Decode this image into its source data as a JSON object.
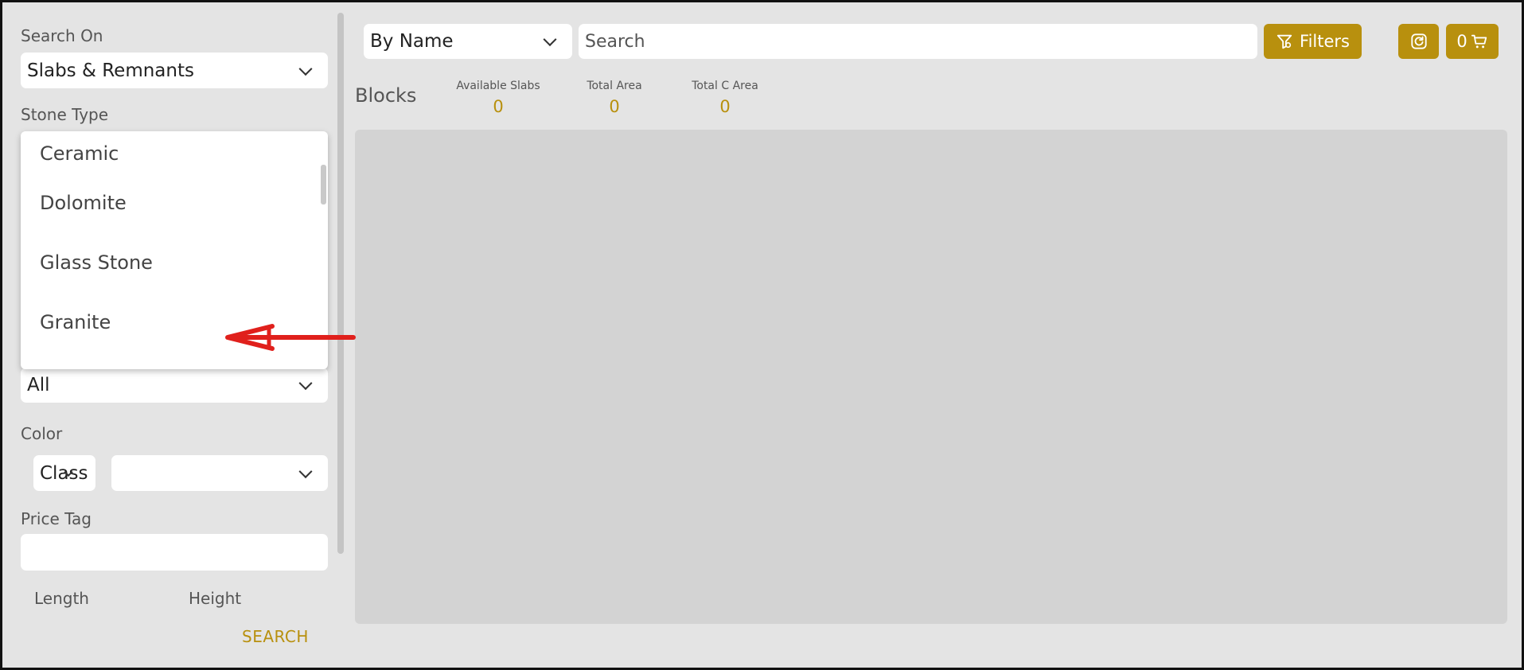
{
  "sidebar": {
    "search_on": {
      "label": "Search On",
      "value": "Slabs & Remnants"
    },
    "stone_type": {
      "label": "Stone Type",
      "options": [
        "Ceramic",
        "Dolomite",
        "Glass Stone",
        "Granite"
      ]
    },
    "hidden_select": {
      "value": "All"
    },
    "color": {
      "label": "Color",
      "class_value": "Class",
      "color_value": ""
    },
    "price_tag": {
      "label": "Price Tag",
      "value": ""
    },
    "length_label": "Length",
    "height_label": "Height",
    "search_button": "SEARCH"
  },
  "topbar": {
    "search_mode": "By Name",
    "search_placeholder": "Search",
    "filters_label": "Filters",
    "cart_count": "0"
  },
  "stats": {
    "title": "Blocks",
    "items": [
      {
        "label": "Available Slabs",
        "value": "0"
      },
      {
        "label": "Total Area",
        "value": "0"
      },
      {
        "label": "Total C Area",
        "value": "0"
      }
    ]
  },
  "colors": {
    "accent": "#b8900e",
    "annotation_arrow": "#e0201c"
  },
  "icons": {
    "filter": "filter-icon",
    "refresh": "refresh-icon",
    "cart": "cart-icon"
  }
}
